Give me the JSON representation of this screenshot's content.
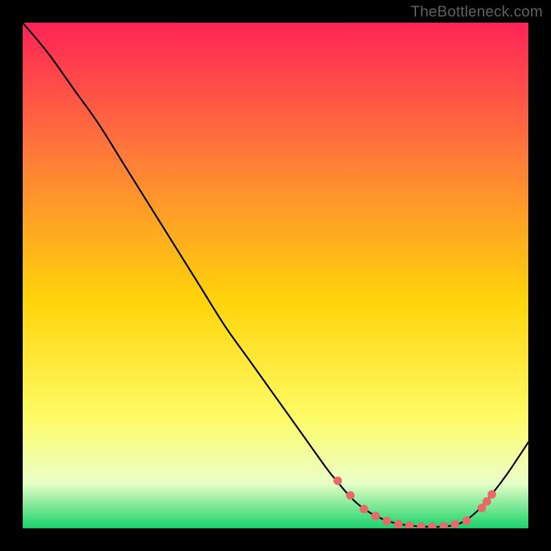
{
  "watermark": "TheBottleneck.com",
  "colors": {
    "frame": "#000000",
    "gradient_top": "#ff2356",
    "gradient_mid_upper": "#ff7a3a",
    "gradient_mid": "#ffd40a",
    "gradient_mid_lower": "#fffb66",
    "gradient_pale": "#eaffc8",
    "gradient_green": "#18d36a",
    "curve": "#000000",
    "marker_fill": "#e66a6a",
    "marker_stroke": "#b83f3f"
  },
  "chart_data": {
    "type": "line",
    "title": "",
    "xlabel": "",
    "ylabel": "",
    "xlim": [
      0,
      100
    ],
    "ylim": [
      0,
      100
    ],
    "series": [
      {
        "name": "bottleneck-curve",
        "x": [
          0,
          5,
          10,
          15,
          20,
          25,
          30,
          35,
          40,
          45,
          50,
          55,
          60,
          62,
          65,
          68,
          72,
          76,
          80,
          84,
          87,
          90,
          93,
          96,
          100
        ],
        "y": [
          100,
          94,
          87,
          80,
          72,
          64,
          56,
          48,
          40,
          33,
          26,
          19,
          12,
          9.5,
          6,
          3.5,
          1.5,
          0.6,
          0.3,
          0.4,
          1.2,
          3.5,
          7,
          11,
          17
        ]
      }
    ],
    "markers": {
      "name": "highlight-points",
      "x": [
        62.3,
        64.8,
        67.5,
        69.8,
        72.0,
        74.3,
        76.5,
        78.8,
        81.0,
        83.3,
        85.5,
        87.8,
        90.8,
        91.8,
        92.8
      ],
      "y": [
        9.4,
        6.5,
        3.8,
        2.4,
        1.4,
        0.8,
        0.5,
        0.35,
        0.3,
        0.4,
        0.8,
        1.5,
        4.0,
        5.3,
        6.7
      ]
    }
  }
}
